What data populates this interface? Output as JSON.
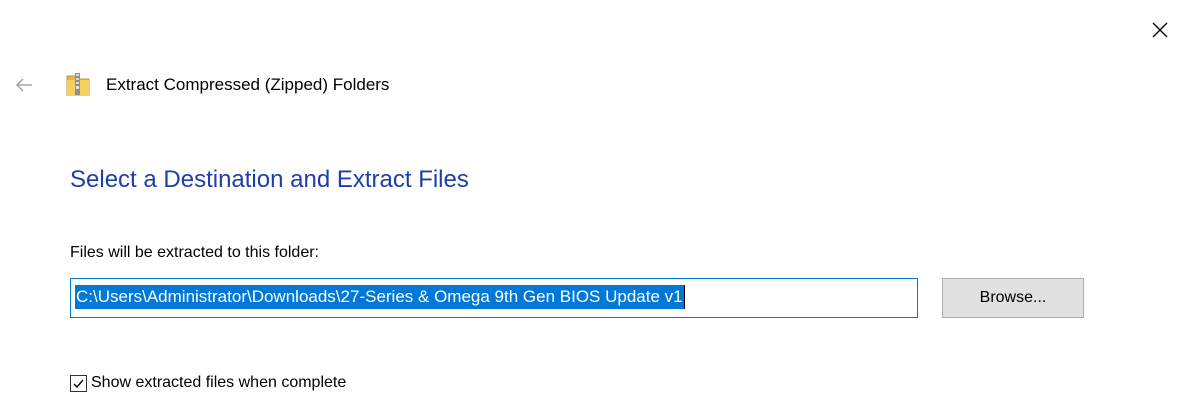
{
  "window": {
    "close_icon": "close-icon"
  },
  "header": {
    "back_icon": "back-arrow-icon",
    "app_icon": "zip-folder-icon",
    "title": "Extract Compressed (Zipped) Folders"
  },
  "main": {
    "heading": "Select a Destination and Extract Files",
    "destination_label": "Files will be extracted to this folder:",
    "destination_path": "C:\\Users\\Administrator\\Downloads\\27-Series & Omega 9th Gen BIOS Update v1",
    "browse_label": "Browse...",
    "show_files_label": "Show extracted files when complete",
    "show_files_checked": true
  },
  "colors": {
    "heading": "#1e3fa8",
    "selection": "#0078d7",
    "button_bg": "#e1e1e1"
  }
}
